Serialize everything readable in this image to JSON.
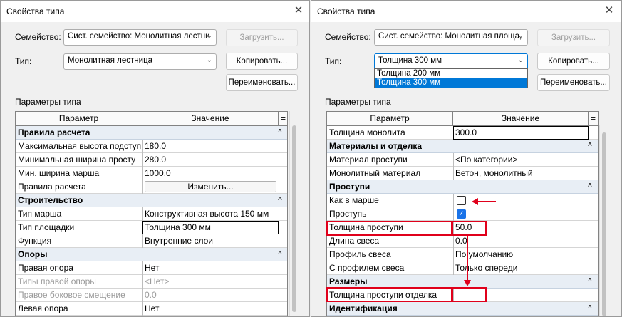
{
  "left": {
    "title": "Свойства типа",
    "family_label": "Семейство:",
    "family_value": "Сист. семейство: Монолитная лестни",
    "type_label": "Тип:",
    "type_value": "Монолитная лестница",
    "load_button": "Загрузить...",
    "copy_button": "Копировать...",
    "rename_button": "Переименовать...",
    "params_label": "Параметры типа",
    "col_param": "Параметр",
    "col_value": "Значение",
    "col_eq": "=",
    "rows": [
      {
        "kind": "group",
        "name": "Правила расчета"
      },
      {
        "kind": "row",
        "name": "Максимальная высота подступ",
        "value": "180.0"
      },
      {
        "kind": "row",
        "name": "Минимальная ширина просту",
        "value": "280.0"
      },
      {
        "kind": "row",
        "name": "Мин. ширина марша",
        "value": "1000.0"
      },
      {
        "kind": "row",
        "name": "Правила расчета",
        "button": "Изменить..."
      },
      {
        "kind": "group",
        "name": "Строительство"
      },
      {
        "kind": "row",
        "name": "Тип марша",
        "value": "Конструктивная высота 150 мм"
      },
      {
        "kind": "row",
        "name": "Тип площадки",
        "value": "Толщина 300 мм",
        "framed": true
      },
      {
        "kind": "row",
        "name": "Функция",
        "value": "Внутренние слои"
      },
      {
        "kind": "group",
        "name": "Опоры"
      },
      {
        "kind": "row",
        "name": "Правая опора",
        "value": "Нет"
      },
      {
        "kind": "row",
        "name": "Типы правой опоры",
        "value": "<Нет>",
        "gray": true
      },
      {
        "kind": "row",
        "name": "Правое боковое смещение",
        "value": "0.0",
        "gray": true
      },
      {
        "kind": "row",
        "name": "Левая опора",
        "value": "Нет"
      }
    ]
  },
  "right": {
    "title": "Свойства типа",
    "family_label": "Семейство:",
    "family_value": "Сист. семейство: Монолитная площа,",
    "type_label": "Тип:",
    "type_value": "Толщина 300 мм",
    "type_options": [
      "Толщина 200 мм",
      "Толщина 300 мм"
    ],
    "type_selected": 1,
    "load_button": "Загрузить...",
    "copy_button": "Копировать...",
    "rename_button": "Переименовать...",
    "params_label": "Параметры типа",
    "col_param": "Параметр",
    "col_value": "Значение",
    "col_eq": "=",
    "rows": [
      {
        "kind": "row",
        "name": "Толщина монолита",
        "value": "300.0",
        "framed": true
      },
      {
        "kind": "group",
        "name": "Материалы и отделка"
      },
      {
        "kind": "row",
        "name": "Материал проступи",
        "value": "<По категории>"
      },
      {
        "kind": "row",
        "name": "Монолитный материал",
        "value": "Бетон, монолитный"
      },
      {
        "kind": "group",
        "name": "Проступи"
      },
      {
        "kind": "row",
        "name": "Как в марше",
        "check": false
      },
      {
        "kind": "row",
        "name": "Проступь",
        "check": true
      },
      {
        "kind": "row",
        "name": "Толщина проступи",
        "value": "50.0"
      },
      {
        "kind": "row",
        "name": "Длина свеса",
        "value": "0.0"
      },
      {
        "kind": "row",
        "name": "Профиль свеса",
        "value": "По умолчанию"
      },
      {
        "kind": "row",
        "name": "С профилем свеса",
        "value": "Только спереди"
      },
      {
        "kind": "group",
        "name": "Размеры"
      },
      {
        "kind": "row",
        "name": "Толщина проступи отделка",
        "value": ""
      },
      {
        "kind": "group",
        "name": "Идентификация"
      }
    ]
  },
  "icons": {
    "close": "close-icon",
    "chevron": "chevron-down-icon",
    "collapse": "collapse-chevron-icon",
    "check": "checkmark-icon"
  },
  "colors": {
    "annotation": "#e0001b",
    "selection": "#0078d7",
    "checkbox": "#1a73e8"
  }
}
